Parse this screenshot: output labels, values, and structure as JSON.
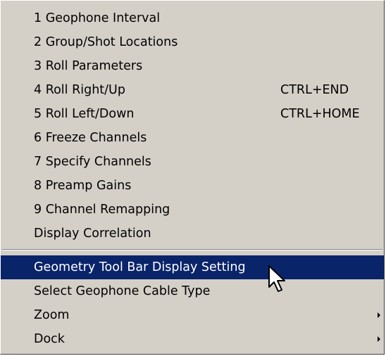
{
  "menu": {
    "group1": [
      {
        "label": "1 Geophone Interval",
        "shortcut": ""
      },
      {
        "label": "2 Group/Shot Locations",
        "shortcut": ""
      },
      {
        "label": "3 Roll Parameters",
        "shortcut": ""
      },
      {
        "label": "4 Roll Right/Up",
        "shortcut": "CTRL+END"
      },
      {
        "label": "5 Roll Left/Down",
        "shortcut": "CTRL+HOME"
      },
      {
        "label": "6 Freeze Channels",
        "shortcut": ""
      },
      {
        "label": "7 Specify Channels",
        "shortcut": ""
      },
      {
        "label": "8 Preamp Gains",
        "shortcut": ""
      },
      {
        "label": "9 Channel Remapping",
        "shortcut": ""
      },
      {
        "label": "Display Correlation",
        "shortcut": ""
      }
    ],
    "group2": [
      {
        "label": "Geometry Tool Bar Display Setting",
        "highlighted": true
      },
      {
        "label": "Select Geophone Cable Type"
      },
      {
        "label": "Zoom",
        "submenu": true
      },
      {
        "label": "Dock",
        "submenu": true
      }
    ]
  },
  "colors": {
    "menu_background": "#d4d0c8",
    "highlight": "#0a246a",
    "highlight_text": "#ffffff"
  },
  "icons": {
    "pointer": "arrow-cursor-icon",
    "submenu": "submenu-arrow-icon"
  }
}
